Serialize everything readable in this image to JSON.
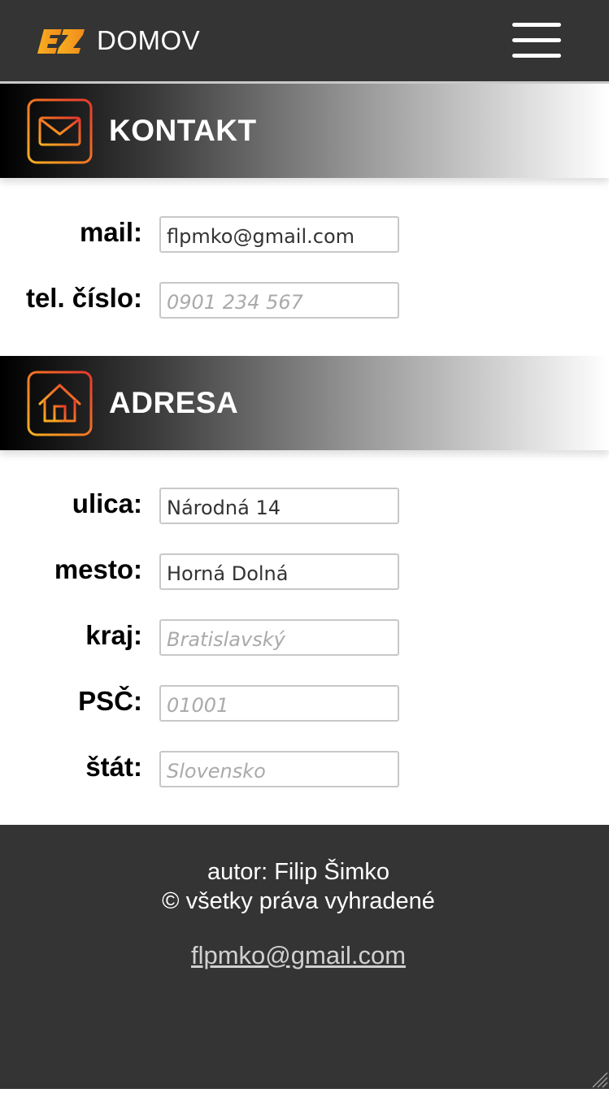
{
  "nav": {
    "logo_text": "EZ",
    "title": "DOMOV",
    "menu_icon": "hamburger-menu-icon"
  },
  "colors": {
    "bar": "#333433",
    "accent_orange": "#f39a1e",
    "accent_red": "#e8382e",
    "white": "#ffffff"
  },
  "contact": {
    "title": "KONTAKT",
    "icon": "envelope-icon",
    "fields": {
      "mail": {
        "label": "mail:",
        "value": "flpmko@gmail.com",
        "placeholder": ""
      },
      "phone": {
        "label": "tel. číslo:",
        "value": "",
        "placeholder": "0901 234 567"
      }
    }
  },
  "address": {
    "title": "ADRESA",
    "icon": "home-icon",
    "fields": {
      "street": {
        "label": "ulica:",
        "value": "Národná 14",
        "placeholder": ""
      },
      "city": {
        "label": "mesto:",
        "value": "Horná Dolná",
        "placeholder": ""
      },
      "region": {
        "label": "kraj:",
        "value": "",
        "placeholder": "Bratislavský"
      },
      "zip": {
        "label": "PSČ:",
        "value": "",
        "placeholder": "01001"
      },
      "country": {
        "label": "štát:",
        "value": "",
        "placeholder": "Slovensko"
      }
    }
  },
  "footer": {
    "author": "autor: Filip Šimko",
    "rights": "© všetky práva vyhradené",
    "email": "flpmko@gmail.com"
  }
}
